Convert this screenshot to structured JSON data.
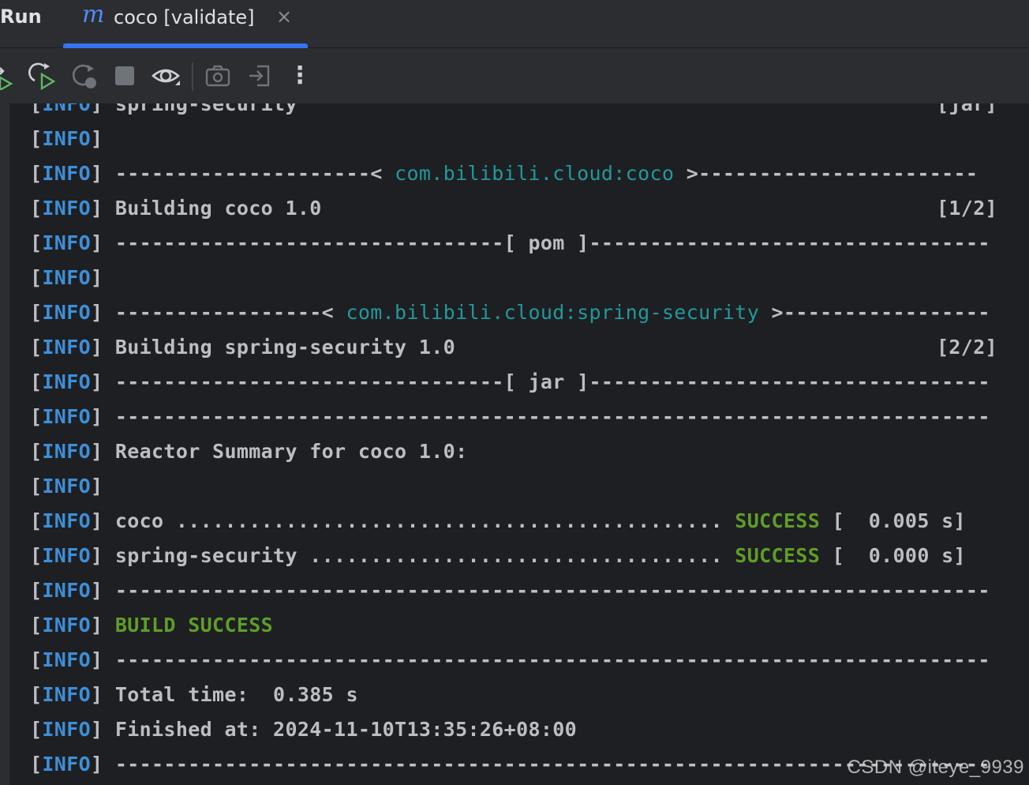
{
  "header": {
    "title": "Run",
    "tab": {
      "icon": "maven-icon",
      "icon_glyph": "m",
      "label": "coco [validate]",
      "close_glyph": "×"
    }
  },
  "toolbar": {
    "buttons": [
      {
        "name": "rerun-icon"
      },
      {
        "name": "rerun-failed-icon"
      },
      {
        "name": "restart-icon"
      },
      {
        "name": "stop-icon"
      },
      {
        "name": "show-icon"
      },
      {
        "name": "screenshot-icon"
      },
      {
        "name": "import-icon"
      },
      {
        "name": "more-icon",
        "glyph": "⋮"
      }
    ]
  },
  "console": {
    "level": "INFO",
    "lines": [
      {
        "text": "spring-security",
        "right": "[jar]"
      },
      {
        "text": ""
      },
      {
        "dash_left": "---------------------< ",
        "link": "com.bilibili.cloud:coco",
        "dash_right": " >-----------------------"
      },
      {
        "text": "Building coco 1.0",
        "right": "[1/2]"
      },
      {
        "dash_left": "--------------------------------[ ",
        "link_plain": "pom",
        "dash_right": " ]---------------------------------"
      },
      {
        "text": ""
      },
      {
        "dash_left": "-----------------< ",
        "link": "com.bilibili.cloud:spring-security",
        "dash_right": " >-----------------"
      },
      {
        "text": "Building spring-security 1.0",
        "right": "[2/2]"
      },
      {
        "dash_left": "--------------------------------[ ",
        "link_plain": "jar",
        "dash_right": " ]---------------------------------"
      },
      {
        "text": "------------------------------------------------------------------------"
      },
      {
        "text": "Reactor Summary for coco 1.0:"
      },
      {
        "text": ""
      },
      {
        "text": "coco ............................................. ",
        "status": "SUCCESS",
        "tail": " [  0.005 s]"
      },
      {
        "text": "spring-security .................................. ",
        "status": "SUCCESS",
        "tail": " [  0.000 s]"
      },
      {
        "text": "------------------------------------------------------------------------"
      },
      {
        "status": "BUILD SUCCESS"
      },
      {
        "text": "------------------------------------------------------------------------"
      },
      {
        "text": "Total time:  0.385 s"
      },
      {
        "text": "Finished at: 2024-11-10T13:35:26+08:00"
      },
      {
        "text": "------------------------------------------------------------------------"
      }
    ]
  },
  "watermark": "CSDN @iteye_9939",
  "colors": {
    "info": "#3d8fd9",
    "link": "#20999d",
    "success": "#5f9d29",
    "tab_underline": "#3574f0"
  }
}
